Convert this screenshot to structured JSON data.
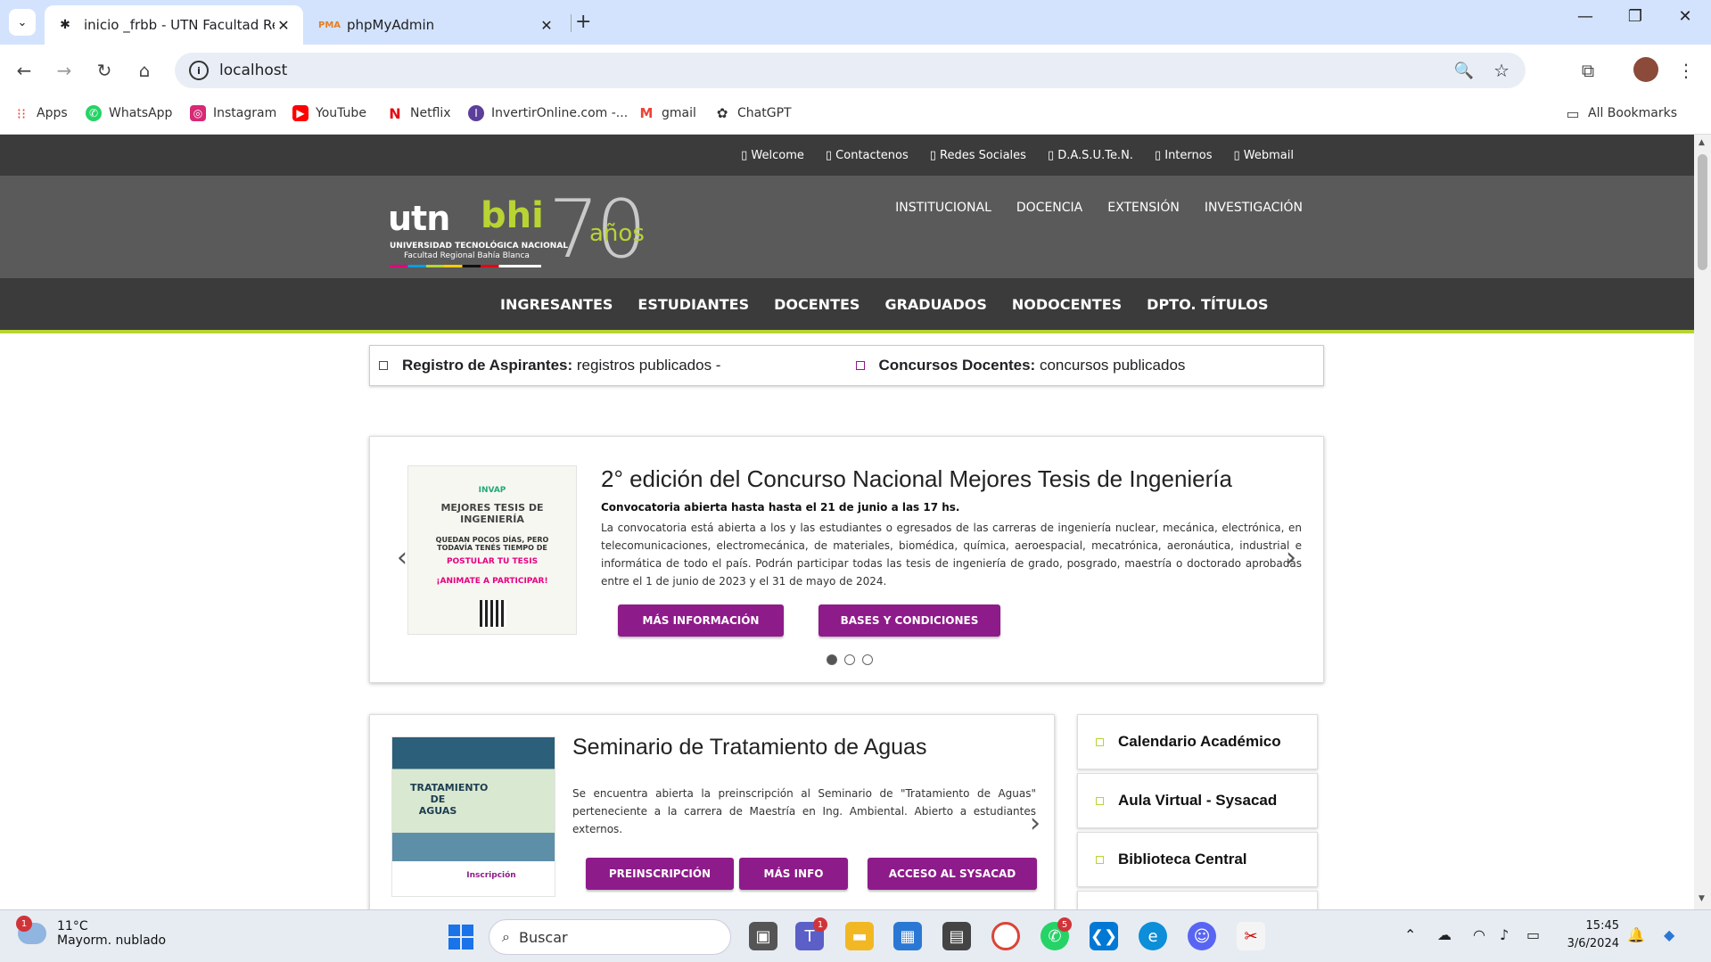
{
  "browser": {
    "tabs": [
      {
        "title": "inicio _frbb - UTN Facultad Regi",
        "active": true
      },
      {
        "title": "phpMyAdmin",
        "active": false
      }
    ],
    "url": "localhost",
    "bookmarks": [
      "Apps",
      "WhatsApp",
      "Instagram",
      "YouTube",
      "Netflix",
      "InvertirOnline.com -...",
      "gmail",
      "ChatGPT"
    ],
    "all_bookmarks": "All Bookmarks"
  },
  "site": {
    "top_links": [
      "Welcome",
      "Contactenos",
      "Redes Sociales",
      "D.A.S.U.Te.N.",
      "Internos",
      "Webmail"
    ],
    "logo": {
      "utn": "utn",
      "bhi": "bhi",
      "seventy": "70",
      "anos": "años",
      "university": "UNIVERSIDAD TECNOLÓGICA NACIONAL",
      "faculty": "Facultad Regional Bahía Blanca"
    },
    "main_menu": [
      "INSTITUCIONAL",
      "DOCENCIA",
      "EXTENSIÓN",
      "INVESTIGACIÓN"
    ],
    "nav": [
      "INGRESANTES",
      "ESTUDIANTES",
      "DOCENTES",
      "GRADUADOS",
      "NODOCENTES",
      "DPTO. TÍTULOS"
    ],
    "info_bar": [
      {
        "label": "Registro de Aspirantes:",
        "text": "registros publicados -"
      },
      {
        "label": "Concursos Docentes:",
        "text": "concursos publicados"
      }
    ],
    "slider": {
      "title": "2° edición del Concurso Nacional Mejores Tesis de Ingeniería",
      "subtitle": "Convocatoria abierta hasta hasta el 21 de junio a las 17 hs.",
      "body": "La convocatoria está abierta a los y las estudiantes o egresados de las carreras de ingeniería nuclear, mecánica, electrónica, en telecomunicaciones, electromecánica, de materiales, biomédica, química, aeroespacial, mecatrónica, aeronáutica, industrial e informática de todo el país. Podrán participar todas las tesis de ingeniería de grado, posgrado, maestría o doctorado aprobadas entre el 1 de junio de 2023 y el 31 de mayo de 2024.",
      "btn_info": "MÁS INFORMACIÓN",
      "btn_bases": "BASES Y CONDICIONES",
      "poster": {
        "org": "INVAP",
        "title": "MEJORES TESIS DE INGENIERÍA",
        "line1": "QUEDAN POCOS DÍAS, PERO TODAVÍA TENÉS TIEMPO DE",
        "line2": "POSTULAR TU TESIS",
        "line3": "¡ANIMATE A PARTICIPAR!"
      }
    },
    "news": {
      "title": "Seminario de Tratamiento de Aguas",
      "body": "Se encuentra abierta la preinscripción al Seminario de \"Tratamiento de Aguas\" perteneciente a la carrera de Maestría en Ing. Ambiental. Abierto a estudiantes externos.",
      "buttons": [
        "PREINSCRIPCIÓN",
        "MÁS INFO",
        "ACCESO AL SYSACAD"
      ],
      "poster": {
        "title": "TRATAMIENTO DE AGUAS",
        "footer": "Inscripción"
      }
    },
    "sidebar": [
      "Calendario Académico",
      "Aula Virtual - Sysacad",
      "Biblioteca Central"
    ]
  },
  "taskbar": {
    "weather_temp": "11°C",
    "weather_cond": "Mayorm. nublado",
    "weather_badge": "1",
    "search": "Buscar",
    "time": "15:45",
    "date": "3/6/2024",
    "teams_badge": "1",
    "whatsapp_badge": "5"
  },
  "colors": {
    "accent": "#8e1b8a",
    "brand_green": "#b7d433",
    "dark": "#3b3b3b"
  }
}
